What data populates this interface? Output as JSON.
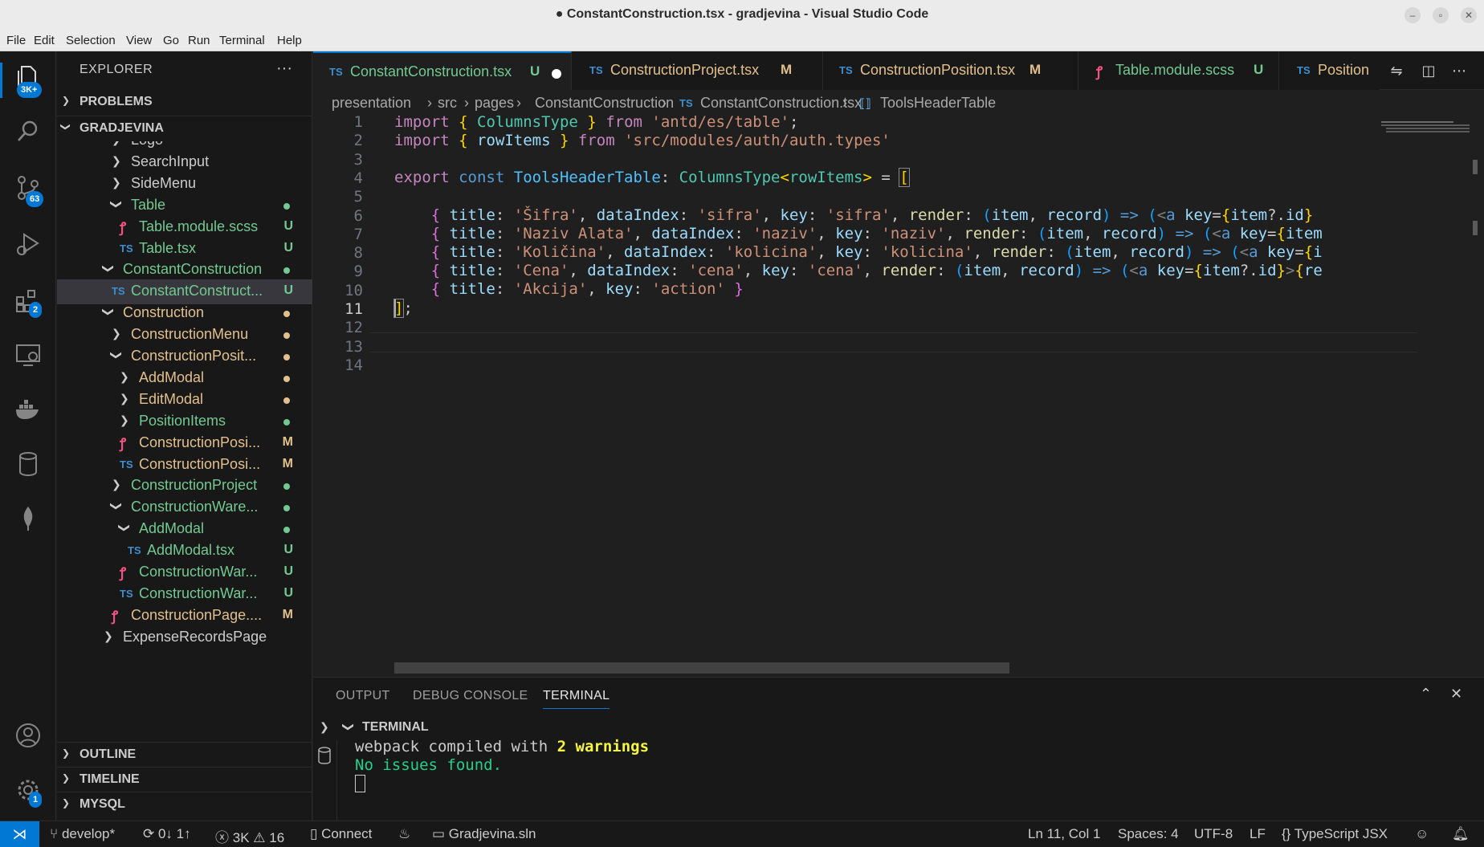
{
  "window": {
    "title": "● ConstantConstruction.tsx - gradjevina - Visual Studio Code"
  },
  "menu": [
    "File",
    "Edit",
    "Selection",
    "View",
    "Go",
    "Run",
    "Terminal",
    "Help"
  ],
  "activity": {
    "explorer_badge": "3K+",
    "scm_badge": "63",
    "extensions_badge": "2",
    "settings_badge": "1"
  },
  "explorer": {
    "header": "EXPLORER",
    "more": "···",
    "problems": "PROBLEMS",
    "root": "GRADJEVINA",
    "items": [
      {
        "name": "Logo",
        "depth": 5,
        "kind": "folder-closed",
        "status": "",
        "color": "#cccccc"
      },
      {
        "name": "SearchInput",
        "depth": 5,
        "kind": "folder-closed",
        "status": "",
        "color": "#cccccc"
      },
      {
        "name": "SideMenu",
        "depth": 5,
        "kind": "folder-closed",
        "status": "",
        "color": "#cccccc"
      },
      {
        "name": "Table",
        "depth": 5,
        "kind": "folder-open",
        "status": "dot",
        "color": "#73c991"
      },
      {
        "name": "Table.module.scss",
        "depth": 6,
        "kind": "scss",
        "status": "U",
        "color": "#73c991"
      },
      {
        "name": "Table.tsx",
        "depth": 6,
        "kind": "ts",
        "status": "U",
        "color": "#73c991"
      },
      {
        "name": "ConstantConstruction",
        "depth": 4,
        "kind": "folder-open",
        "status": "dot",
        "color": "#73c991"
      },
      {
        "name": "ConstantConstruct...",
        "depth": 5,
        "kind": "ts",
        "status": "U",
        "color": "#73c991",
        "selected": true
      },
      {
        "name": "Construction",
        "depth": 4,
        "kind": "folder-open",
        "status": "dot-m",
        "color": "#e2c08d"
      },
      {
        "name": "ConstructionMenu",
        "depth": 5,
        "kind": "folder-closed",
        "status": "dot-m",
        "color": "#e2c08d"
      },
      {
        "name": "ConstructionPosit...",
        "depth": 5,
        "kind": "folder-open",
        "status": "dot-m",
        "color": "#e2c08d"
      },
      {
        "name": "AddModal",
        "depth": 6,
        "kind": "folder-closed",
        "status": "dot-m",
        "color": "#e2c08d"
      },
      {
        "name": "EditModal",
        "depth": 6,
        "kind": "folder-closed",
        "status": "dot-m",
        "color": "#e2c08d"
      },
      {
        "name": "PositionItems",
        "depth": 6,
        "kind": "folder-closed",
        "status": "dot",
        "color": "#73c991"
      },
      {
        "name": "ConstructionPosi...",
        "depth": 6,
        "kind": "scss",
        "status": "M",
        "color": "#e2c08d"
      },
      {
        "name": "ConstructionPosi...",
        "depth": 6,
        "kind": "ts",
        "status": "M",
        "color": "#e2c08d"
      },
      {
        "name": "ConstructionProject",
        "depth": 5,
        "kind": "folder-closed",
        "status": "dot",
        "color": "#73c991"
      },
      {
        "name": "ConstructionWare...",
        "depth": 5,
        "kind": "folder-open",
        "status": "dot",
        "color": "#73c991"
      },
      {
        "name": "AddModal",
        "depth": 6,
        "kind": "folder-open",
        "status": "dot",
        "color": "#73c991"
      },
      {
        "name": "AddModal.tsx",
        "depth": 7,
        "kind": "ts",
        "status": "U",
        "color": "#73c991"
      },
      {
        "name": "ConstructionWar...",
        "depth": 6,
        "kind": "scss",
        "status": "U",
        "color": "#73c991"
      },
      {
        "name": "ConstructionWar...",
        "depth": 6,
        "kind": "ts",
        "status": "U",
        "color": "#73c991"
      },
      {
        "name": "ConstructionPage....",
        "depth": 5,
        "kind": "scss",
        "status": "M",
        "color": "#e2c08d"
      },
      {
        "name": "ExpenseRecordsPage",
        "depth": 4,
        "kind": "folder-closed",
        "status": "",
        "color": "#cccccc"
      }
    ],
    "outline": "OUTLINE",
    "timeline": "TIMELINE",
    "mysql": "MYSQL"
  },
  "tabs": [
    {
      "icon": "TS",
      "label": "ConstantConstruction.tsx",
      "suffix": "U",
      "dirty": true,
      "active": true,
      "color": "#73c991"
    },
    {
      "icon": "TS",
      "label": "ConstructionProject.tsx",
      "suffix": "M",
      "color": "#e2c08d"
    },
    {
      "icon": "TS",
      "label": "ConstructionPosition.tsx",
      "suffix": "M",
      "color": "#e2c08d"
    },
    {
      "icon": "scss",
      "label": "Table.module.scss",
      "suffix": "U",
      "color": "#73c991"
    },
    {
      "icon": "TS",
      "label": "Position",
      "suffix": "",
      "color": "#e2c08d"
    }
  ],
  "breadcrumb": [
    "presentation",
    "src",
    "pages",
    "ConstantConstruction",
    "ConstantConstruction.tsx",
    "ToolsHeaderTable"
  ],
  "editor": {
    "line_numbers": [
      "1",
      "2",
      "3",
      "4",
      "5",
      "6",
      "7",
      "8",
      "9",
      "10",
      "11",
      "12",
      "13",
      "14"
    ],
    "current_line": "11"
  },
  "panel": {
    "tabs": [
      "OUTPUT",
      "DEBUG CONSOLE",
      "TERMINAL"
    ],
    "active_tab": "TERMINAL",
    "terminal_header": "TERMINAL",
    "line1_prefix": "webpack compiled with ",
    "line1_count": "2 warnings",
    "line2": "No issues found."
  },
  "status": {
    "branch": "develop*",
    "sync": "0↓ 1↑",
    "errors": "3K",
    "warnings": "16",
    "connect": "Connect",
    "solution": "Gradjevina.sln",
    "position": "Ln 11, Col 1",
    "spaces": "Spaces: 4",
    "encoding": "UTF-8",
    "eol": "LF",
    "language": "TypeScript JSX"
  }
}
